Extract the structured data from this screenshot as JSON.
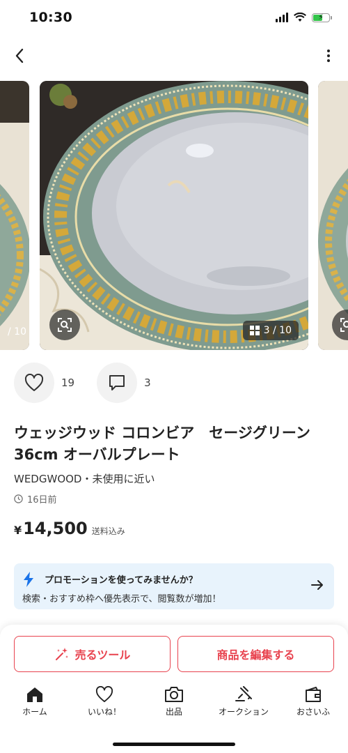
{
  "status_bar": {
    "time": "10:30",
    "battery_percent": 60
  },
  "nav": {
    "back_icon": "chevron-left-icon",
    "more_icon": "more-vertical-icon"
  },
  "carousel": {
    "current": 3,
    "total": 10,
    "counter_text": "3 / 10",
    "prev_counter_text": "/ 10",
    "lens_icon": "image-search-icon"
  },
  "actions": {
    "likes": "19",
    "comments": "3"
  },
  "item": {
    "title": "ウェッジウッド コロンビア　セージグリーン 36cm オーバルプレート",
    "meta": "WEDGWOOD・未使用に近い",
    "posted": "16日前",
    "price_symbol": "¥",
    "price": "14,500",
    "price_note": "送料込み"
  },
  "promo": {
    "title": "プロモーションを使ってみませんか？",
    "text": "検索・おすすめ枠へ優先表示で、閲覧数が増加！"
  },
  "buttons": {
    "sell_tools": "売るツール",
    "edit_item": "商品を編集する"
  },
  "tabs": [
    {
      "label": "ホーム",
      "icon": "home-icon"
    },
    {
      "label": "いいね！",
      "icon": "heart-icon"
    },
    {
      "label": "出品",
      "icon": "camera-icon"
    },
    {
      "label": "オークション",
      "icon": "gavel-icon"
    },
    {
      "label": "おさいふ",
      "icon": "wallet-icon"
    }
  ],
  "colors": {
    "accent": "#e8424e",
    "promo_bg": "#e8f3fc",
    "promo_icon": "#1a73e8"
  }
}
